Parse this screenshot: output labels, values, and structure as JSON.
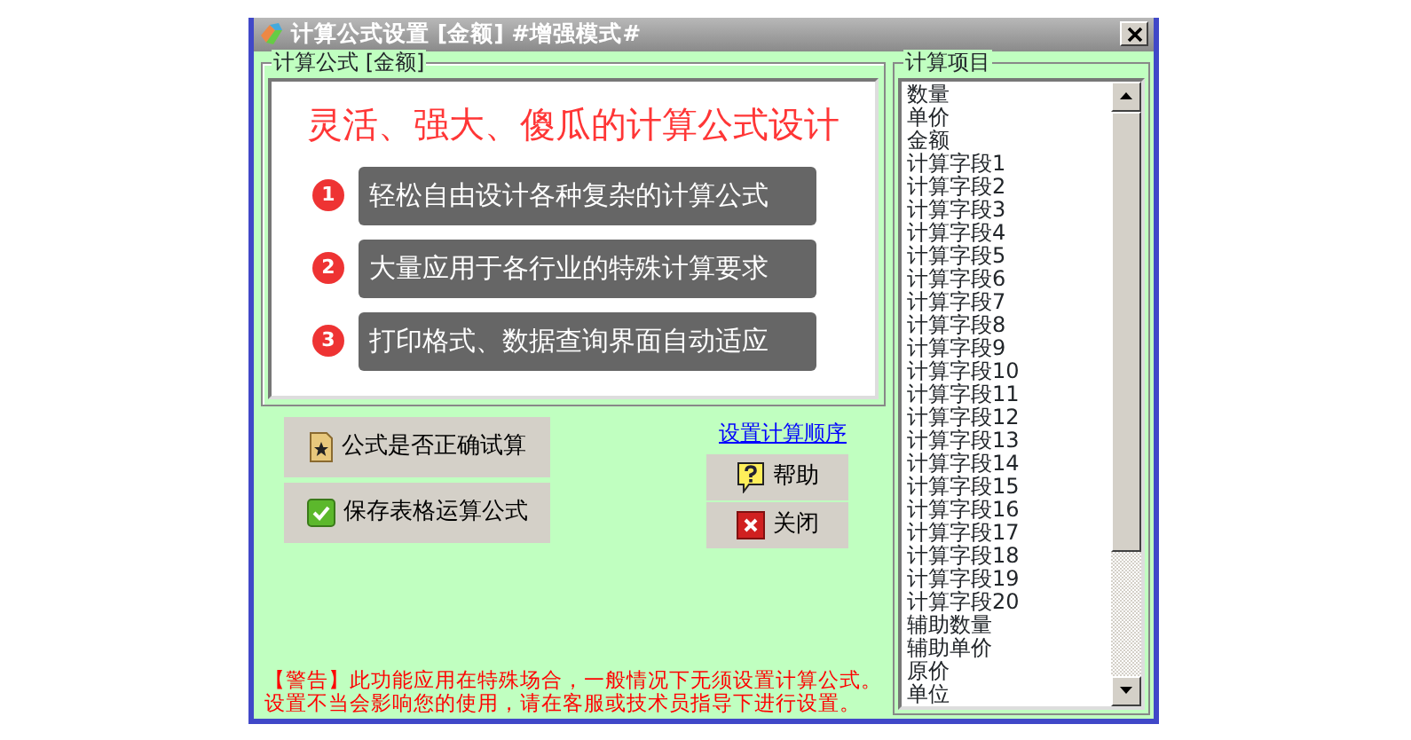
{
  "window": {
    "title": "计算公式设置 [金额] #增强模式#"
  },
  "formula_group": {
    "legend": "计算公式 [金额]",
    "headline": "灵活、强大、傻瓜的计算公式设计",
    "features": [
      {
        "number": "1",
        "text": "轻松自由设计各种复杂的计算公式"
      },
      {
        "number": "2",
        "text": "大量应用于各行业的特殊计算要求"
      },
      {
        "number": "3",
        "text": "打印格式、数据查询界面自动适应"
      }
    ]
  },
  "action_buttons": [
    {
      "label": "公式是否正确试算",
      "kind": "test"
    },
    {
      "label": "保存表格运算公式",
      "kind": "save"
    }
  ],
  "order_link": "设置计算顺序",
  "side_buttons": [
    {
      "label": "帮助",
      "kind": "help"
    },
    {
      "label": "关闭",
      "kind": "close"
    }
  ],
  "warning": {
    "lines": [
      "【警告】此功能应用在特殊场合，一般情况下无须设置计算公式。",
      "设置不当会影响您的使用，请在客服或技术员指导下进行设置。"
    ]
  },
  "items_group": {
    "legend": "计算项目",
    "items": [
      "数量",
      "单价",
      "金额",
      "计算字段1",
      "计算字段2",
      "计算字段3",
      "计算字段4",
      "计算字段5",
      "计算字段6",
      "计算字段7",
      "计算字段8",
      "计算字段9",
      "计算字段10",
      "计算字段11",
      "计算字段12",
      "计算字段13",
      "计算字段14",
      "计算字段15",
      "计算字段16",
      "计算字段17",
      "计算字段18",
      "计算字段19",
      "计算字段20",
      "辅助数量",
      "辅助单价",
      "原价",
      "单位"
    ]
  }
}
